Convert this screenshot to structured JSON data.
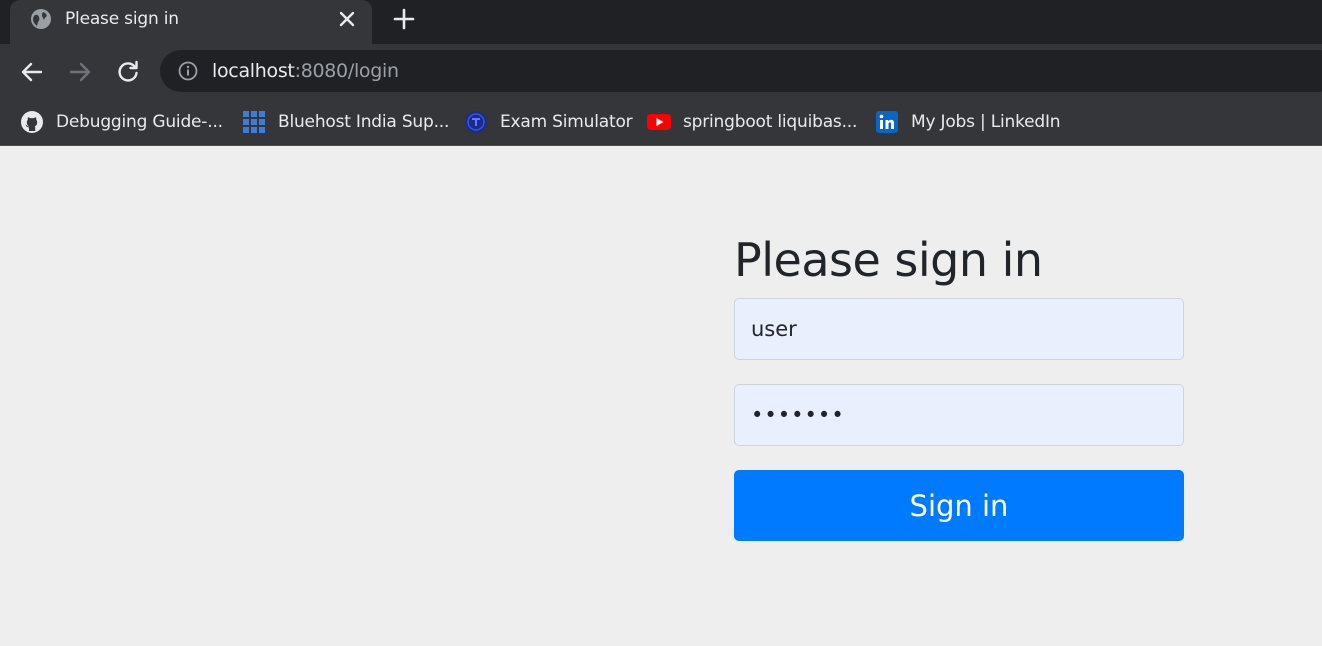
{
  "browser": {
    "tab": {
      "title": "Please sign in",
      "icon": "globe-icon"
    },
    "address_bar": {
      "host": "localhost",
      "path": ":8080/login",
      "icon": "info-icon"
    },
    "bookmarks": [
      {
        "label": "Debugging Guide-...",
        "icon": "github-icon"
      },
      {
        "label": "Bluehost India Sup...",
        "icon": "bluehost-grid-icon"
      },
      {
        "label": "Exam Simulator",
        "icon": "exam-simulator-icon"
      },
      {
        "label": "springboot liquibas...",
        "icon": "youtube-icon"
      },
      {
        "label": "My Jobs | LinkedIn",
        "icon": "linkedin-icon"
      }
    ]
  },
  "login": {
    "heading": "Please sign in",
    "username_value": "user",
    "password_value": "•••••••",
    "submit_label": "Sign in"
  },
  "colors": {
    "primary": "#007bff",
    "autofill": "#e8f0fe",
    "page_background": "#eeeeee"
  }
}
